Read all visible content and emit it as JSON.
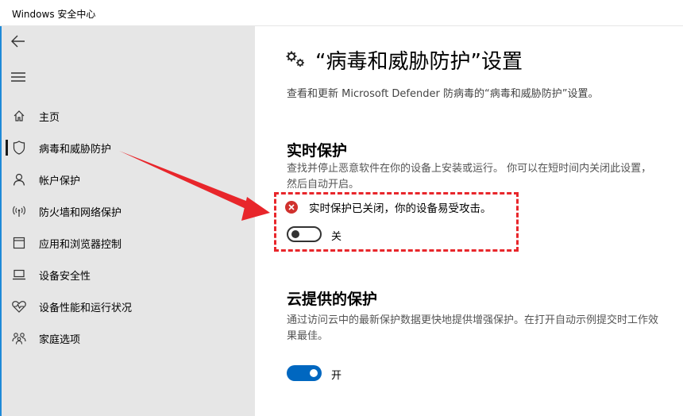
{
  "window": {
    "title": "Windows 安全中心"
  },
  "sidebar": {
    "back_icon": "back-arrow-icon",
    "menu_icon": "hamburger-menu-icon",
    "items": [
      {
        "label": "主页",
        "icon": "home-icon"
      },
      {
        "label": "病毒和威胁防护",
        "icon": "shield-icon",
        "active": true
      },
      {
        "label": "帐户保护",
        "icon": "person-icon"
      },
      {
        "label": "防火墙和网络保护",
        "icon": "wireless-antenna-icon"
      },
      {
        "label": "应用和浏览器控制",
        "icon": "app-window-icon"
      },
      {
        "label": "设备安全性",
        "icon": "laptop-icon"
      },
      {
        "label": "设备性能和运行状况",
        "icon": "heart-pulse-icon"
      },
      {
        "label": "家庭选项",
        "icon": "family-icon"
      }
    ],
    "accent_color": "#1f8ad8"
  },
  "main": {
    "title": "“病毒和威胁防护”设置",
    "title_icon": "gears-icon",
    "subtitle": "查看和更新 Microsoft Defender 防病毒的“病毒和威胁防护”设置。",
    "realtime": {
      "heading": "实时保护",
      "description": "查找并停止恶意软件在你的设备上安装或运行。 你可以在短时间内关闭此设置，然后自动开启。",
      "alert_text": "实时保护已关闭，你的设备易受攻击。",
      "alert_icon": "error-x-icon",
      "toggle_state": false,
      "toggle_label": "关"
    },
    "cloud": {
      "heading": "云提供的保护",
      "description": "通过访问云中的最新保护数据更快地提供增强保护。在打开自动示例提交时工作效果最佳。",
      "toggle_state": true,
      "toggle_label": "开"
    }
  },
  "annotations": {
    "highlight_color": "#e8262b"
  }
}
